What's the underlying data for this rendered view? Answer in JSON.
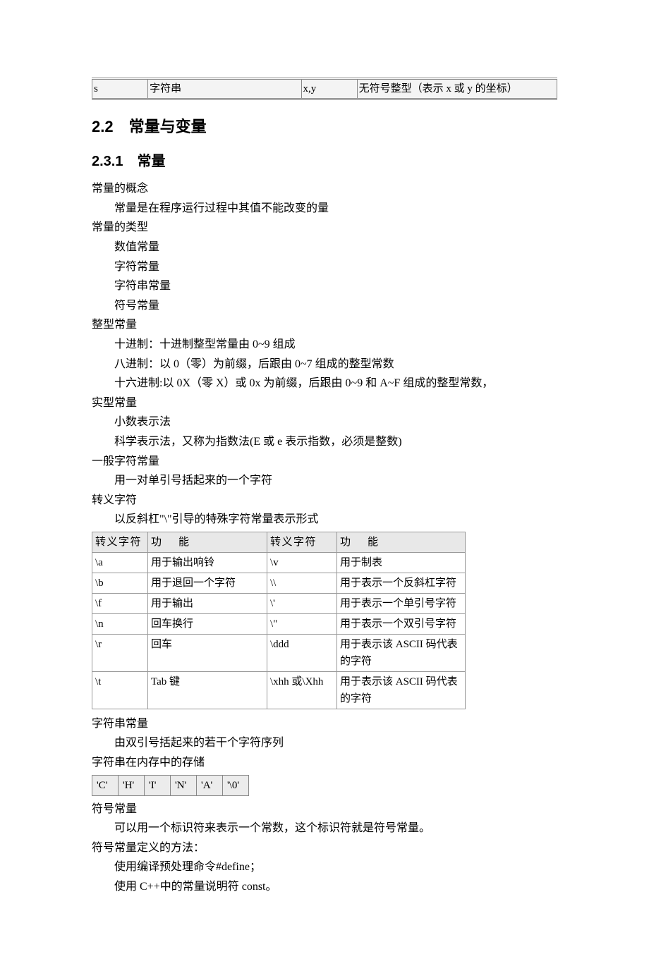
{
  "topTable": {
    "c1": "s",
    "c2": "字符串",
    "c3": "x,y",
    "c4": "无符号整型（表示 x 或 y 的坐标）"
  },
  "heading2": "2.2　常量与变量",
  "heading3": "2.3.1　常量",
  "lines": {
    "l1": "常量的概念",
    "l2": "常量是在程序运行过程中其值不能改变的量",
    "l3": "常量的类型",
    "l4": "数值常量",
    "l5": "字符常量",
    "l6": "字符串常量",
    "l7": "符号常量",
    "l8": "整型常量",
    "l9": "十进制：十进制整型常量由 0~9 组成",
    "l10": "八进制：以 0（零）为前缀，后跟由 0~7 组成的整型常数",
    "l11": "十六进制:以 0X（零 X）或 0x 为前缀，后跟由 0~9 和 A~F 组成的整型常数，",
    "l12": "实型常量",
    "l13": "小数表示法",
    "l14": "科学表示法，又称为指数法(E 或 e 表示指数，必须是整数)",
    "l15": "一般字符常量",
    "l16": "用一对单引号括起来的一个字符",
    "l17": "转义字符",
    "l18": "以反斜杠\"\\\"引导的特殊字符常量表示形式",
    "l19": "字符串常量",
    "l20": "由双引号括起来的若干个字符序列",
    "l21": "字符串在内存中的存储",
    "l22": "符号常量",
    "l23": "可以用一个标识符来表示一个常数，这个标识符就是符号常量。",
    "l24": "符号常量定义的方法：",
    "l25": "使用编译预处理命令#define；",
    "l26": "使用 C++中的常量说明符 const。"
  },
  "escHeader": {
    "h1": "转义字符",
    "h2": "功",
    "h2b": "能",
    "h3": "转义字符",
    "h4": "功",
    "h4b": "能"
  },
  "escRows": [
    {
      "a": "\\a",
      "b": "用于输出响铃",
      "c": "\\v",
      "d": "用于制表"
    },
    {
      "a": "\\b",
      "b": "用于退回一个字符",
      "c": "\\\\",
      "d": "用于表示一个反斜杠字符"
    },
    {
      "a": "\\f",
      "b": "用于输出",
      "c": "\\'",
      "d": "用于表示一个单引号字符"
    },
    {
      "a": "\\n",
      "b": "回车换行",
      "c": "\\\"",
      "d": "用于表示一个双引号字符"
    },
    {
      "a": "\\r",
      "b": "回车",
      "c": "\\ddd",
      "d": "用于表示该 ASCII 码代表的字符"
    },
    {
      "a": "\\t",
      "b": "Tab 键",
      "c": "\\xhh 或\\Xhh",
      "d": "用于表示该 ASCII 码代表的字符"
    }
  ],
  "memCells": [
    "'C'",
    "'H'",
    "'I'",
    "'N'",
    "'A'",
    "'\\0'"
  ]
}
